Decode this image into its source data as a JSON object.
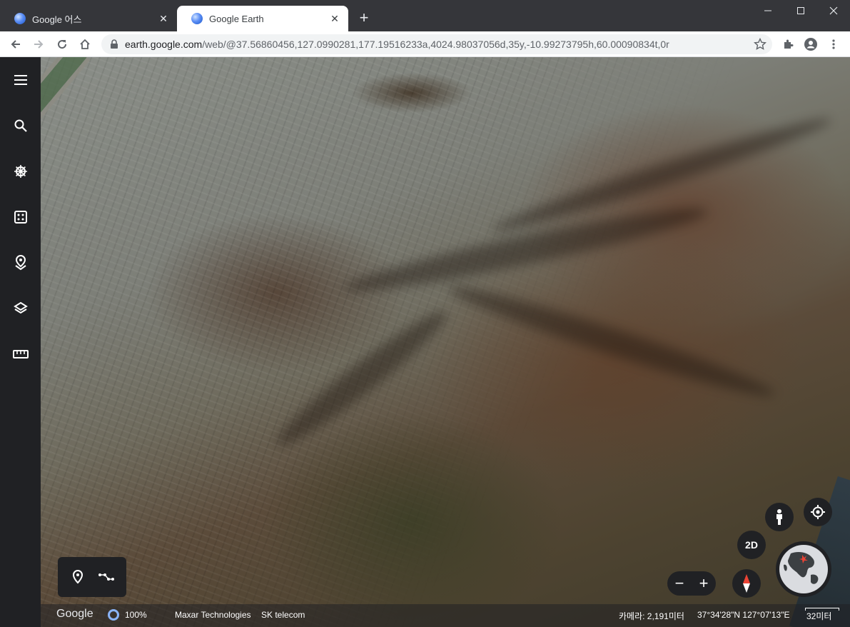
{
  "browser": {
    "tabs": [
      {
        "title": "Google 어스",
        "close": "✕"
      },
      {
        "title": "Google Earth",
        "close": "✕"
      }
    ],
    "new_tab": "+",
    "url_host": "earth.google.com",
    "url_path": "/web/@37.56860456,127.0990281,177.19516233a,4024.98037056d,35y,-10.99273795h,60.00090834t,0r"
  },
  "icons": {
    "rail": [
      "menu-icon",
      "search-icon",
      "voyager-icon",
      "random-icon",
      "projects-icon",
      "map-style-icon",
      "measure-icon"
    ],
    "toolbar": [
      "back-icon",
      "forward-icon",
      "reload-icon",
      "home-icon",
      "lock-icon",
      "star-icon",
      "extensions-icon",
      "profile-icon",
      "more-icon"
    ],
    "controls": [
      "placemark-icon",
      "path-icon",
      "pegman-icon",
      "my-location-icon",
      "compass-icon",
      "globe-icon"
    ]
  },
  "controls": {
    "view_mode": "2D",
    "zoom_out": "−",
    "zoom_in": "+"
  },
  "status": {
    "logo": "Google",
    "load_percent": "100%",
    "credit_1": "Maxar Technologies",
    "credit_2": "SK telecom",
    "camera": "카메라: 2,191미터",
    "coords": "37°34'28\"N 127°07'13\"E",
    "scale": "32미터"
  },
  "colors": {
    "chrome_dark": "#35363a",
    "earth_ui": "#202124",
    "accent": "#8ab4f8"
  }
}
